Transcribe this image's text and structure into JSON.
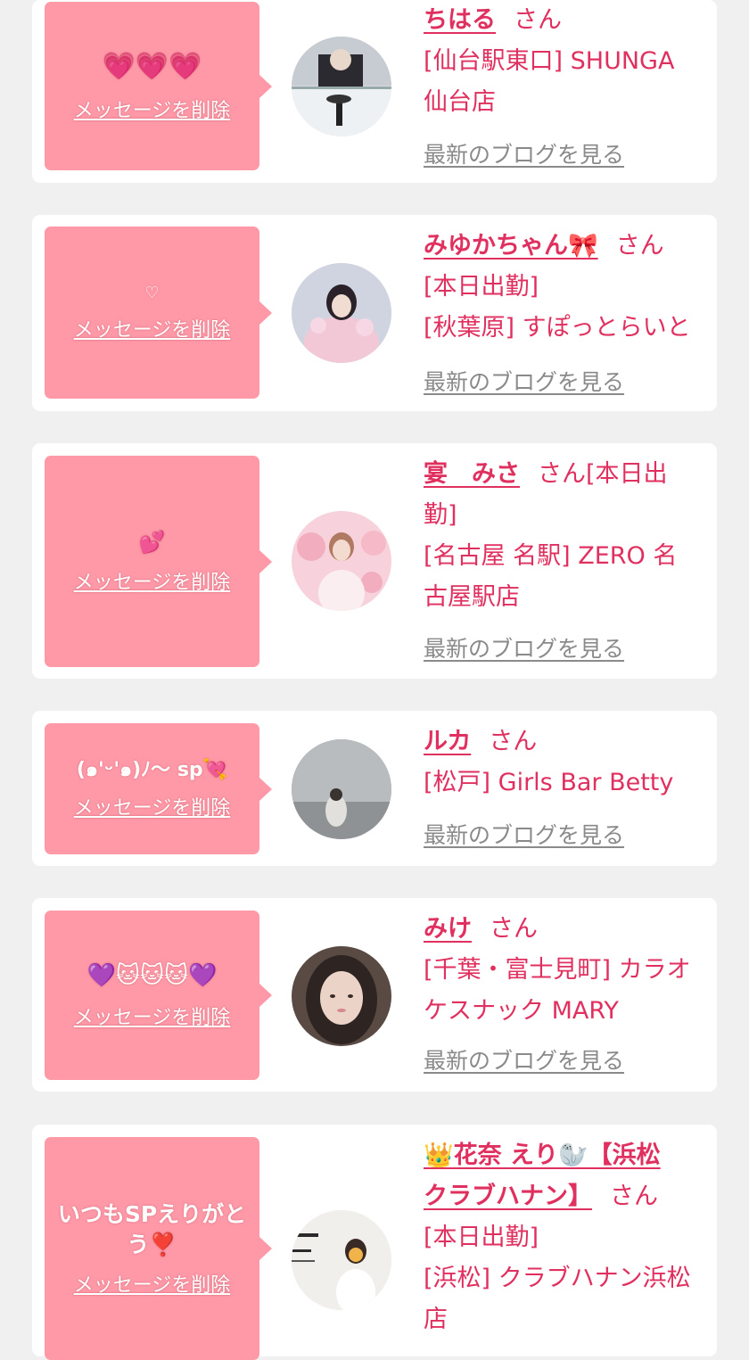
{
  "delete_label": "メッセージを削除",
  "blog_label": "最新のブログを見る",
  "suffix": "さん",
  "colors": {
    "background": "#f0f0f0",
    "card": "#ffffff",
    "bubble": "#ff99a7",
    "accent": "#e0305f",
    "link_gray": "#8a8a8a"
  },
  "cards": [
    {
      "message": "💗💗💗",
      "name": "ちはる",
      "lines": [
        "[仙台駅東口] SHUNGA",
        "仙台店"
      ]
    },
    {
      "message": "♡",
      "name": "みゆかちゃん🎀",
      "lines": [
        "[本日出勤]",
        "[秋葉原] すぽっとらいと"
      ]
    },
    {
      "message": "💕",
      "name": "宴　みさ",
      "inline_after": "[本日出",
      "lines": [
        "勤]",
        "[名古屋 名駅] ZERO 名",
        "古屋駅店"
      ]
    },
    {
      "message": "(๑'ᵕ'๑)ﾉ〜 sp💘",
      "name": "ルカ",
      "lines": [
        "[松戸] Girls Bar Betty"
      ]
    },
    {
      "message": "💜🐱🐱🐱💜",
      "name": "みけ",
      "lines": [
        "[千葉・富士見町] カラオ",
        "ケスナック MARY"
      ]
    },
    {
      "message": "いつもSPえりがとう❣️",
      "name_lines": [
        "👑花奈 えり🦭【浜松",
        "クラブハナン】"
      ],
      "lines": [
        "[本日出勤]",
        "[浜松] クラブハナン浜松",
        "店"
      ]
    }
  ]
}
